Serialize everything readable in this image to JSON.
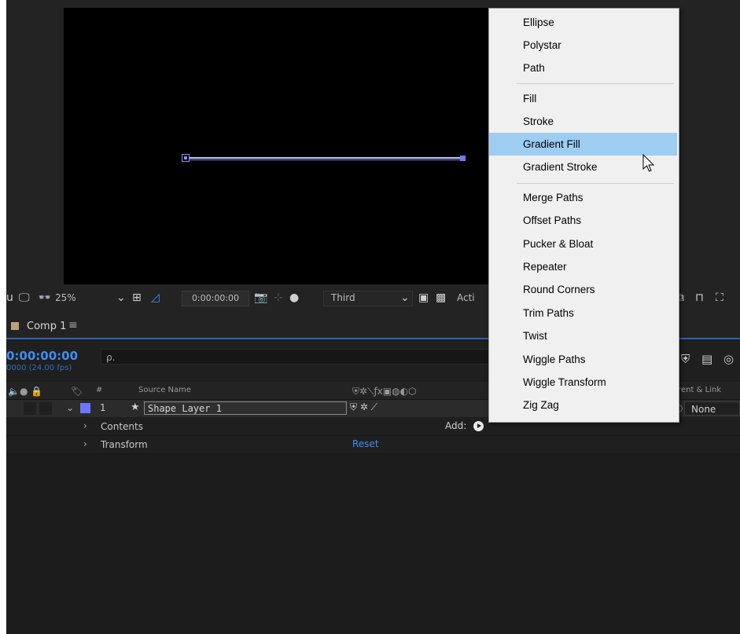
{
  "viewer": {
    "zoom": "25%",
    "timecode": "0:00:00:00",
    "resolution": "Third",
    "view_partial": "Acti"
  },
  "timeline": {
    "tab_name": "Comp 1",
    "tab_menu": "≡",
    "timecode": "0:00:00:00",
    "fps_label": "0000 (24.00 fps)",
    "search_placeholder": "ρ.",
    "columns": {
      "hash": "#",
      "source_name": "Source Name",
      "parent_link": "arent & Link"
    },
    "layer": {
      "number": "1",
      "name": "Shape Layer 1",
      "parent": "None",
      "label_color": "#6a78ff"
    },
    "properties": [
      {
        "name": "Contents",
        "add_label": "Add:"
      },
      {
        "name": "Transform",
        "reset_label": "Reset"
      }
    ]
  },
  "menu": {
    "items": [
      "Ellipse",
      "Polystar",
      "Path",
      "Fill",
      "Stroke",
      "Gradient Fill",
      "Gradient Stroke",
      "Merge Paths",
      "Offset Paths",
      "Pucker & Bloat",
      "Repeater",
      "Round Corners",
      "Trim Paths",
      "Twist",
      "Wiggle Paths",
      "Wiggle Transform",
      "Zig Zag"
    ],
    "highlighted": "Gradient Fill"
  },
  "colors": {
    "accent": "#3d8ef2",
    "highlight": "#9ecdf2"
  }
}
